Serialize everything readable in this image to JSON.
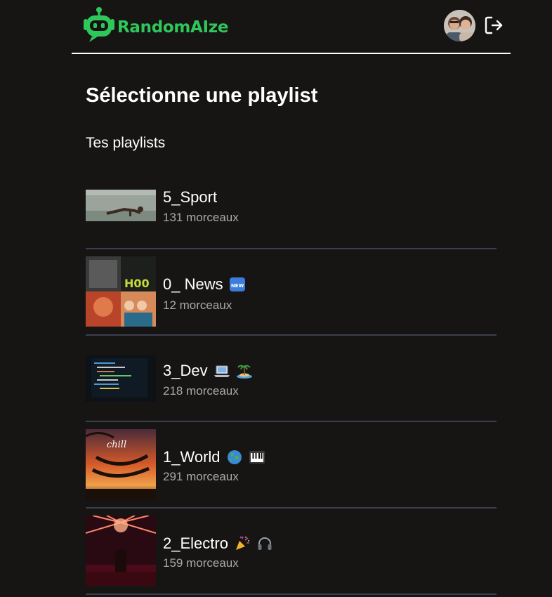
{
  "app": {
    "name": "RandomAIze",
    "brand_color": "#2ec75a"
  },
  "header": {
    "avatar_icon": "user-avatar",
    "logout_icon": "logout-icon"
  },
  "page": {
    "title": "Sélectionne une playlist",
    "section_title": "Tes playlists"
  },
  "playlists": [
    {
      "name": "5_Sport",
      "count": "131 morceaux",
      "emojis": []
    },
    {
      "name": "0_ News",
      "count": "12 morceaux",
      "emojis": [
        "new-badge-icon"
      ]
    },
    {
      "name": "3_Dev",
      "count": "218 morceaux",
      "emojis": [
        "laptop-icon",
        "island-icon"
      ]
    },
    {
      "name": "1_World",
      "count": "291 morceaux",
      "emojis": [
        "globe-icon",
        "piano-icon"
      ]
    },
    {
      "name": "2_Electro",
      "count": "159 morceaux",
      "emojis": [
        "party-popper-icon",
        "headphones-icon"
      ]
    }
  ]
}
